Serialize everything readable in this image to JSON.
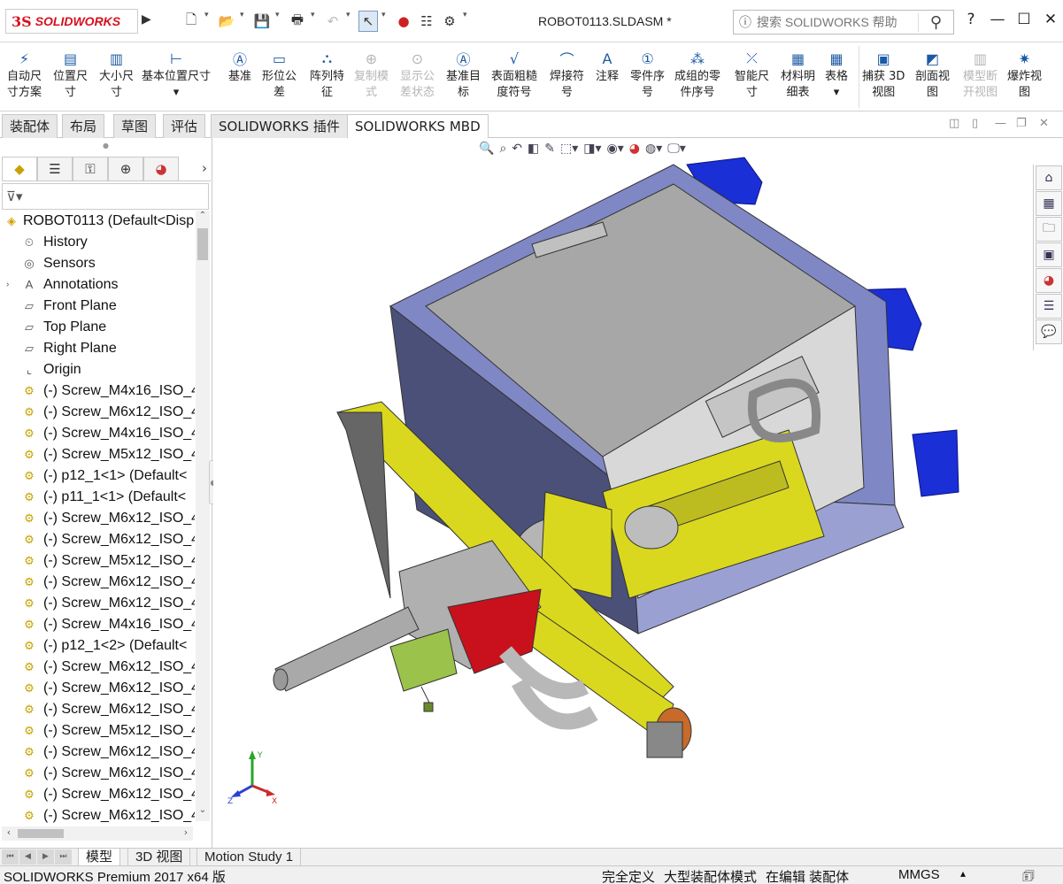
{
  "titlebar": {
    "logo_mark": "3S",
    "logo_text": "SOLIDWORKS",
    "document_title": "ROBOT0113.SLDASM *",
    "search_placeholder": "搜索 SOLIDWORKS 帮助",
    "help_label": "?",
    "minimize_glyph": "—",
    "maximize_glyph": "☐",
    "close_glyph": "✕"
  },
  "ribbon": {
    "buttons": [
      {
        "label1": "自动尺",
        "label2": "寸方案",
        "icon": "auto-dimension-icon"
      },
      {
        "label1": "位置尺",
        "label2": "寸",
        "icon": "location-dimension-icon"
      },
      {
        "label1": "大小尺",
        "label2": "寸",
        "icon": "size-dimension-icon"
      },
      {
        "label1": "基本位置尺寸",
        "label2": "▾",
        "icon": "basic-location-dimension-icon"
      },
      {
        "label1": "基准",
        "label2": "",
        "icon": "datum-icon"
      },
      {
        "label1": "形位公",
        "label2": "差",
        "icon": "geometric-tolerance-icon"
      },
      {
        "label1": "阵列特",
        "label2": "征",
        "icon": "pattern-feature-icon"
      },
      {
        "label1": "复制模",
        "label2": "式",
        "icon": "copy-scheme-icon",
        "disabled": true
      },
      {
        "label1": "显示公",
        "label2": "差状态",
        "icon": "show-tolerance-status-icon",
        "disabled": true
      },
      {
        "label1": "基准目",
        "label2": "标",
        "icon": "datum-target-icon"
      },
      {
        "label1": "表面粗糙",
        "label2": "度符号",
        "icon": "surface-finish-icon"
      },
      {
        "label1": "焊接符",
        "label2": "号",
        "icon": "weld-symbol-icon"
      },
      {
        "label1": "注释",
        "label2": "",
        "icon": "note-icon"
      },
      {
        "label1": "零件序",
        "label2": "号",
        "icon": "balloon-icon"
      },
      {
        "label1": "成组的零",
        "label2": "件序号",
        "icon": "stacked-balloon-icon"
      },
      {
        "label1": "智能尺",
        "label2": "寸",
        "icon": "smart-dimension-icon"
      },
      {
        "label1": "材料明",
        "label2": "细表",
        "icon": "bom-icon"
      },
      {
        "label1": "表格",
        "label2": "▾",
        "icon": "table-icon"
      },
      {
        "label1": "捕获 3D",
        "label2": "视图",
        "icon": "capture-3d-view-icon"
      },
      {
        "label1": "剖面视",
        "label2": "图",
        "icon": "section-view-icon"
      },
      {
        "label1": "模型断",
        "label2": "开视图",
        "icon": "model-break-view-icon",
        "disabled": true
      },
      {
        "label1": "爆炸视",
        "label2": "图",
        "icon": "exploded-view-icon"
      }
    ]
  },
  "command_tabs": [
    {
      "label": "装配体",
      "active": false
    },
    {
      "label": "布局",
      "active": false
    },
    {
      "label": "草图",
      "active": false
    },
    {
      "label": "评估",
      "active": false
    },
    {
      "label": "SOLIDWORKS 插件",
      "active": false
    },
    {
      "label": "SOLIDWORKS MBD",
      "active": true
    }
  ],
  "feature_tree": {
    "root": "ROBOT0113  (Default<Disp",
    "items": [
      {
        "label": "History",
        "icon": "history-icon",
        "expandable": false
      },
      {
        "label": "Sensors",
        "icon": "sensors-icon",
        "expandable": false
      },
      {
        "label": "Annotations",
        "icon": "annotations-icon",
        "expandable": true
      },
      {
        "label": "Front Plane",
        "icon": "plane-icon",
        "expandable": false
      },
      {
        "label": "Top Plane",
        "icon": "plane-icon",
        "expandable": false
      },
      {
        "label": "Right Plane",
        "icon": "plane-icon",
        "expandable": false
      },
      {
        "label": "Origin",
        "icon": "origin-icon",
        "expandable": false
      },
      {
        "label": "(-) Screw_M4x16_ISO_4",
        "icon": "part-icon",
        "expandable": false
      },
      {
        "label": "(-) Screw_M6x12_ISO_4",
        "icon": "part-icon",
        "expandable": false
      },
      {
        "label": "(-) Screw_M4x16_ISO_4",
        "icon": "part-icon",
        "expandable": false
      },
      {
        "label": "(-) Screw_M5x12_ISO_4",
        "icon": "part-icon",
        "expandable": false
      },
      {
        "label": "(-) p12_1<1> (Default<",
        "icon": "part-icon",
        "expandable": false
      },
      {
        "label": "(-) p11_1<1> (Default<",
        "icon": "part-icon",
        "expandable": false
      },
      {
        "label": "(-) Screw_M6x12_ISO_4",
        "icon": "part-icon",
        "expandable": false
      },
      {
        "label": "(-) Screw_M6x12_ISO_4",
        "icon": "part-icon",
        "expandable": false
      },
      {
        "label": "(-) Screw_M5x12_ISO_4",
        "icon": "part-icon",
        "expandable": false
      },
      {
        "label": "(-) Screw_M6x12_ISO_4",
        "icon": "part-icon",
        "expandable": false
      },
      {
        "label": "(-) Screw_M6x12_ISO_4",
        "icon": "part-icon",
        "expandable": false
      },
      {
        "label": "(-) Screw_M4x16_ISO_4",
        "icon": "part-icon",
        "expandable": false
      },
      {
        "label": "(-) p12_1<2> (Default<",
        "icon": "part-icon",
        "expandable": false
      },
      {
        "label": "(-) Screw_M6x12_ISO_4",
        "icon": "part-icon",
        "expandable": false
      },
      {
        "label": "(-) Screw_M6x12_ISO_4",
        "icon": "part-icon",
        "expandable": false
      },
      {
        "label": "(-) Screw_M6x12_ISO_4",
        "icon": "part-icon",
        "expandable": false
      },
      {
        "label": "(-) Screw_M5x12_ISO_4",
        "icon": "part-icon",
        "expandable": false
      },
      {
        "label": "(-) Screw_M6x12_ISO_4",
        "icon": "part-icon",
        "expandable": false
      },
      {
        "label": "(-) Screw_M6x12_ISO_4",
        "icon": "part-icon",
        "expandable": false
      },
      {
        "label": "(-) Screw_M6x12_ISO_4",
        "icon": "part-icon",
        "expandable": false
      },
      {
        "label": "(-) Screw_M6x12_ISO_4",
        "icon": "part-icon",
        "expandable": false
      }
    ]
  },
  "viewport": {
    "triad_labels": {
      "x": "X",
      "y": "Y",
      "z": "Z"
    },
    "colors": {
      "frame": "#7f88c4",
      "plate": "#a0a0a0",
      "yellow": "#d9d81f",
      "red": "#c8111c",
      "blue": "#1a2fd6",
      "green": "#9bc24a"
    }
  },
  "bottom_tabs": [
    {
      "label": "模型",
      "active": true
    },
    {
      "label": "3D 视图",
      "active": false
    },
    {
      "label": "Motion Study 1",
      "active": false
    }
  ],
  "statusbar": {
    "product": "SOLIDWORKS Premium 2017 x64 版",
    "state": "完全定义",
    "mode": "大型装配体模式",
    "editing": "在编辑 装配体",
    "units": "MMGS",
    "units_arrow": "▴"
  }
}
